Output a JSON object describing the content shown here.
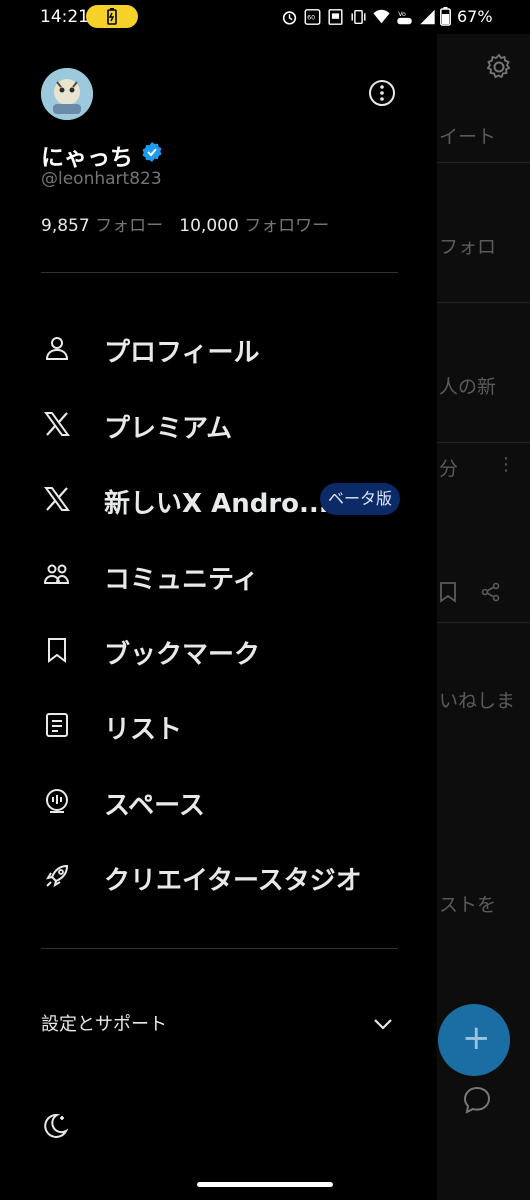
{
  "status_bar": {
    "time": "14:21",
    "battery_percent": "67%"
  },
  "profile": {
    "display_name": "にゃっち",
    "handle": "@leonhart823",
    "following_count": "9,857",
    "following_label": "フォロー",
    "followers_count": "10,000",
    "followers_label": "フォロワー"
  },
  "menu": {
    "items": [
      {
        "label": "プロフィール",
        "icon": "person-icon"
      },
      {
        "label": "プレミアム",
        "icon": "x-logo-icon"
      },
      {
        "label": "新しいX Andro...",
        "icon": "x-logo-icon",
        "badge": "ベータ版"
      },
      {
        "label": "コミュニティ",
        "icon": "communities-icon"
      },
      {
        "label": "ブックマーク",
        "icon": "bookmark-icon"
      },
      {
        "label": "リスト",
        "icon": "list-icon"
      },
      {
        "label": "スペース",
        "icon": "spaces-icon"
      },
      {
        "label": "クリエイタースタジオ",
        "icon": "rocket-icon"
      }
    ]
  },
  "settings_support": {
    "label": "設定とサポート"
  },
  "background": {
    "texts": [
      "イート",
      "フォロ",
      "人の新",
      "分",
      "いねしま",
      "ストを"
    ]
  },
  "colors": {
    "accent": "#1d9bf0",
    "fab": "#1a6ea3",
    "badge_bg": "#0c2a66"
  }
}
